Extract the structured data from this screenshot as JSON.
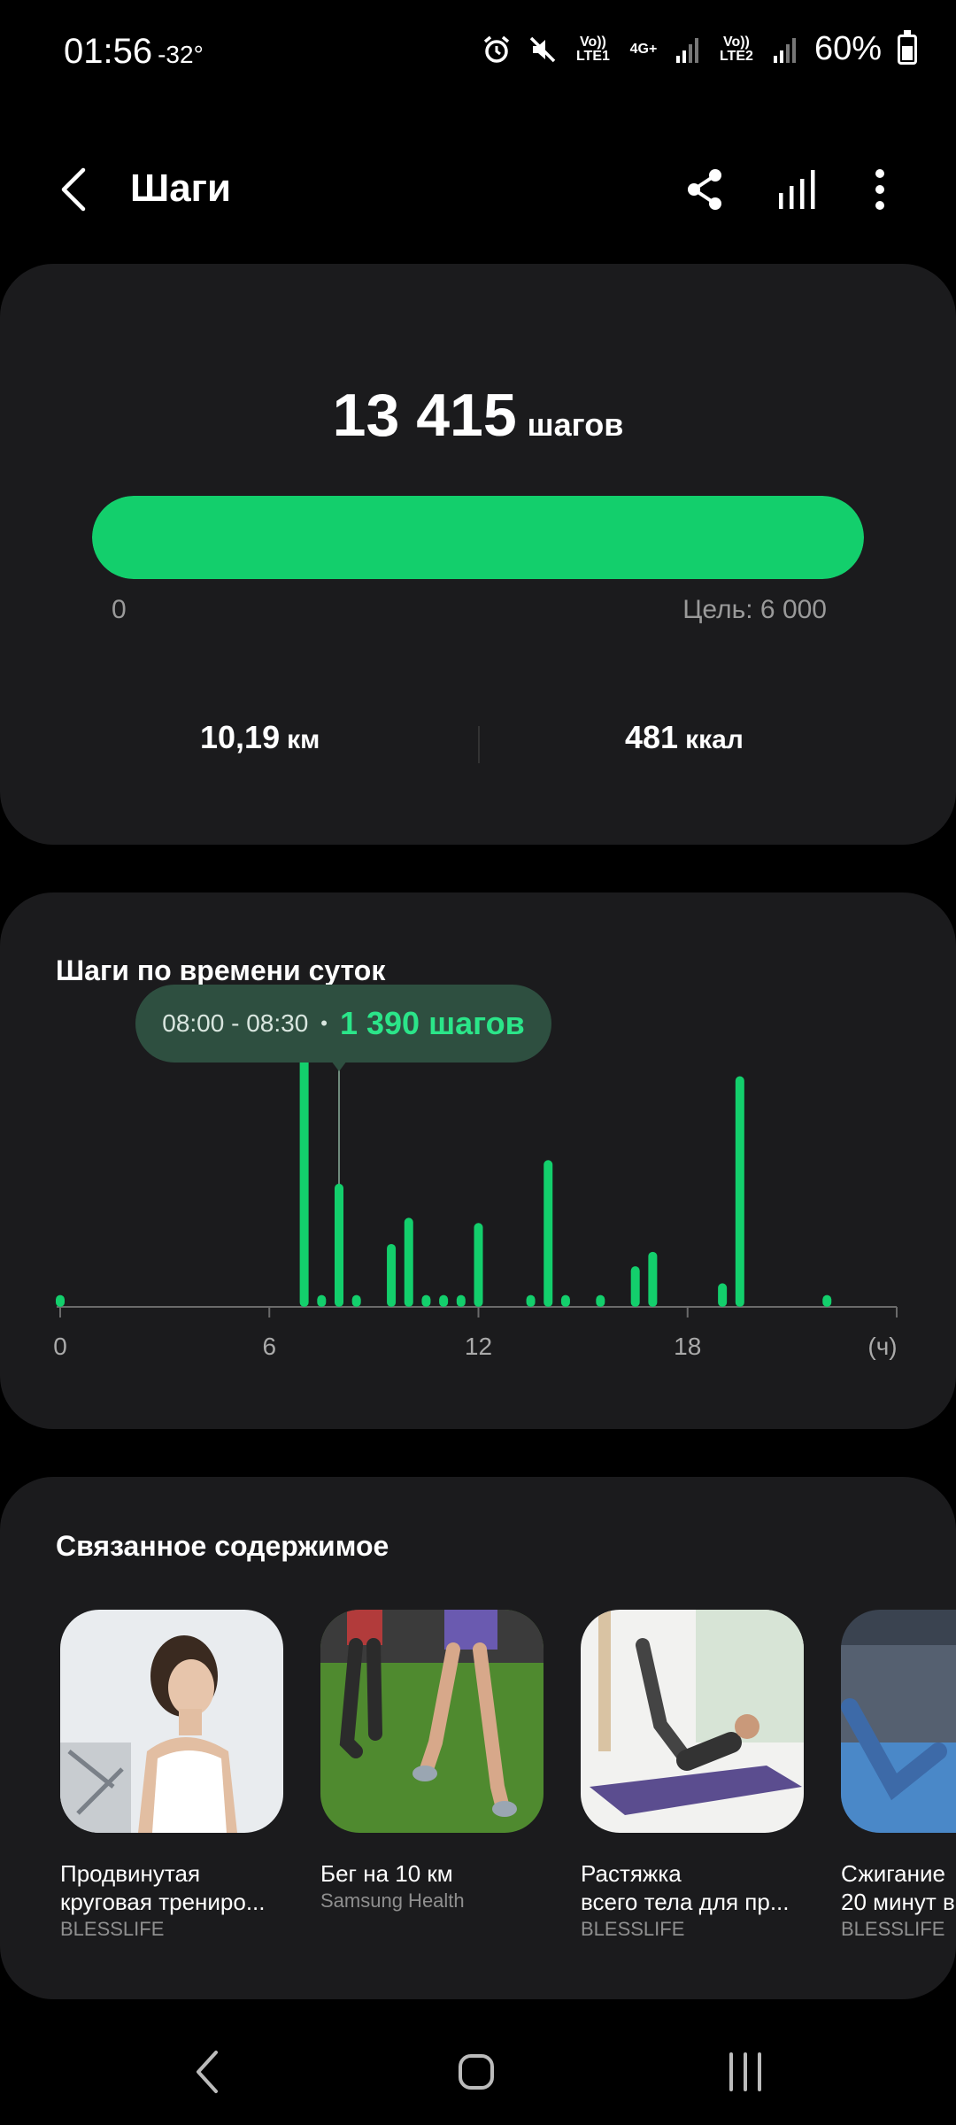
{
  "status_bar": {
    "time": "01:56",
    "temperature": "-32°",
    "network1": "Vo)) LTE1",
    "network_type": "4G+",
    "network2": "Vo)) LTE2",
    "battery": "60%",
    "battery_level": 0.6
  },
  "header": {
    "title": "Шаги"
  },
  "summary": {
    "steps_value": "13 415",
    "steps_unit": "шагов",
    "goal_min": "0",
    "goal_label": "Цель: 6 000",
    "progress_fraction": 1.0,
    "distance_value": "10,19",
    "distance_unit": "км",
    "calories_value": "481",
    "calories_unit": "ккал",
    "accent_color": "#13cf6c"
  },
  "chart_section": {
    "title": "Шаги по времени суток",
    "tooltip_range": "08:00 - 08:30",
    "tooltip_separator": "•",
    "tooltip_value": "1 390 шагов"
  },
  "chart_data": {
    "type": "bar",
    "xlabel": "(ч)",
    "x_ticks": [
      "0",
      "6",
      "12",
      "18"
    ],
    "xlim": [
      0,
      24
    ],
    "ylim": [
      0,
      2000
    ],
    "selected_x": 8.0,
    "x": [
      0.0,
      7.0,
      7.5,
      8.0,
      8.5,
      9.5,
      10.0,
      10.5,
      11.0,
      11.5,
      12.0,
      13.5,
      14.0,
      14.5,
      15.5,
      16.5,
      17.0,
      19.0,
      19.5,
      22.0
    ],
    "values": [
      90,
      2050,
      90,
      940,
      90,
      480,
      680,
      90,
      90,
      90,
      640,
      90,
      1120,
      90,
      90,
      310,
      420,
      180,
      1760,
      90
    ]
  },
  "related": {
    "title": "Связанное содержимое",
    "items": [
      {
        "title": "Продвинутая",
        "subtitle": "круговая трениро...",
        "source": "BLESSLIFE"
      },
      {
        "title": "Бег на 10 км",
        "subtitle": "",
        "source": "Samsung Health"
      },
      {
        "title": "Растяжка",
        "subtitle": "всего тела для пр...",
        "source": "BLESSLIFE"
      },
      {
        "title": "Сжигание",
        "subtitle": "20 минут в",
        "source": "BLESSLIFE"
      }
    ]
  }
}
